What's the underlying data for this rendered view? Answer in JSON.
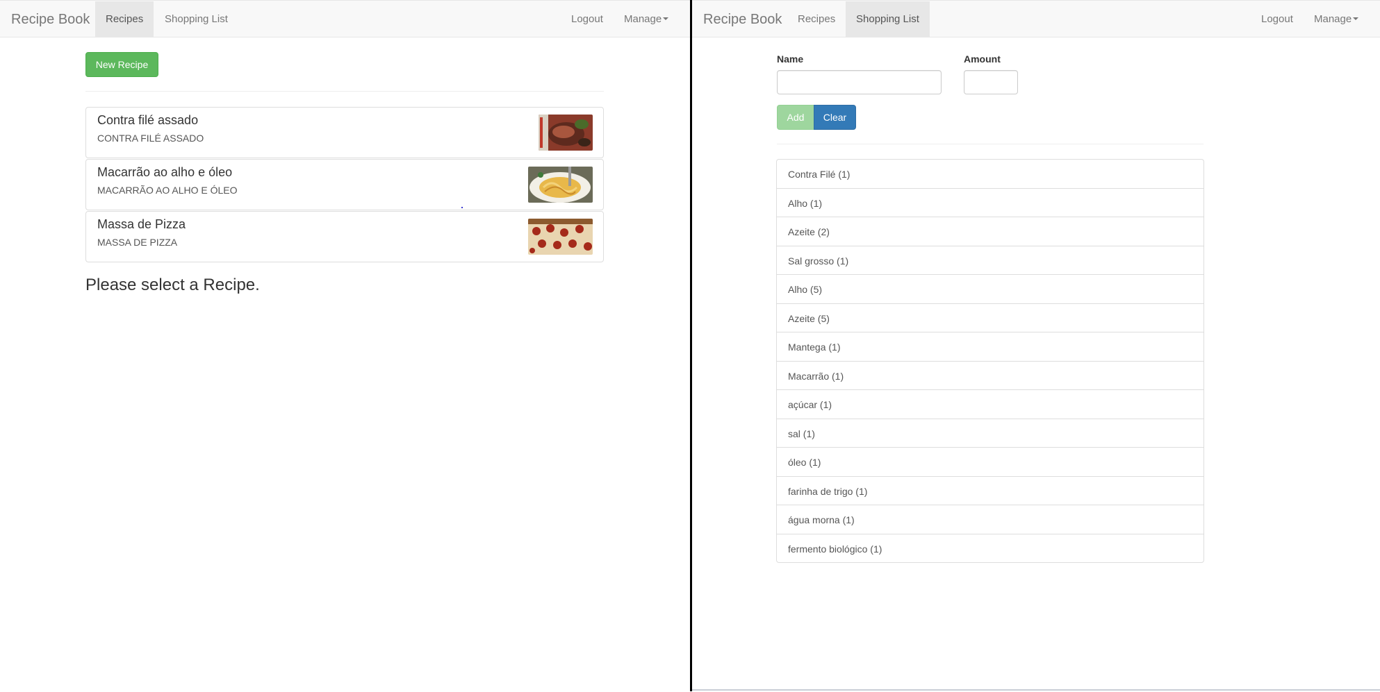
{
  "left": {
    "navbar": {
      "brand": "Recipe Book",
      "links": [
        "Recipes",
        "Shopping List"
      ],
      "active": "Recipes",
      "logout": "Logout",
      "manage": "Manage"
    },
    "new_recipe_label": "New Recipe",
    "recipes": [
      {
        "name": "Contra filé assado",
        "description": "CONTRA FILÉ ASSADO",
        "image": "roast-beef-photo"
      },
      {
        "name": "Macarrão ao alho e óleo",
        "description": "MACARRÃO AO ALHO E ÓLEO",
        "image": "pasta-photo"
      },
      {
        "name": "Massa de Pizza",
        "description": "MASSA DE PIZZA",
        "image": "pizza-photo"
      }
    ],
    "select_message": "Please select a Recipe."
  },
  "right": {
    "navbar": {
      "brand": "Recipe Book",
      "links": [
        "Recipes",
        "Shopping List"
      ],
      "active": "Shopping List",
      "logout": "Logout",
      "manage": "Manage"
    },
    "form": {
      "name_label": "Name",
      "name_value": "",
      "amount_label": "Amount",
      "amount_value": "",
      "add_label": "Add",
      "clear_label": "Clear"
    },
    "ingredients": [
      "Contra Filé (1)",
      "Alho (1)",
      "Azeite (2)",
      "Sal grosso (1)",
      "Alho (5)",
      "Azeite (5)",
      "Mantega (1)",
      "Macarrão (1)",
      "açúcar (1)",
      "sal (1)",
      "óleo (1)",
      "farinha de trigo (1)",
      "água morna (1)",
      "fermento biológico (1)"
    ]
  },
  "colors": {
    "navbar_bg": "#f8f8f8",
    "active_tab_bg": "#e7e7e7",
    "success": "#5cb85c",
    "primary": "#337ab7"
  }
}
